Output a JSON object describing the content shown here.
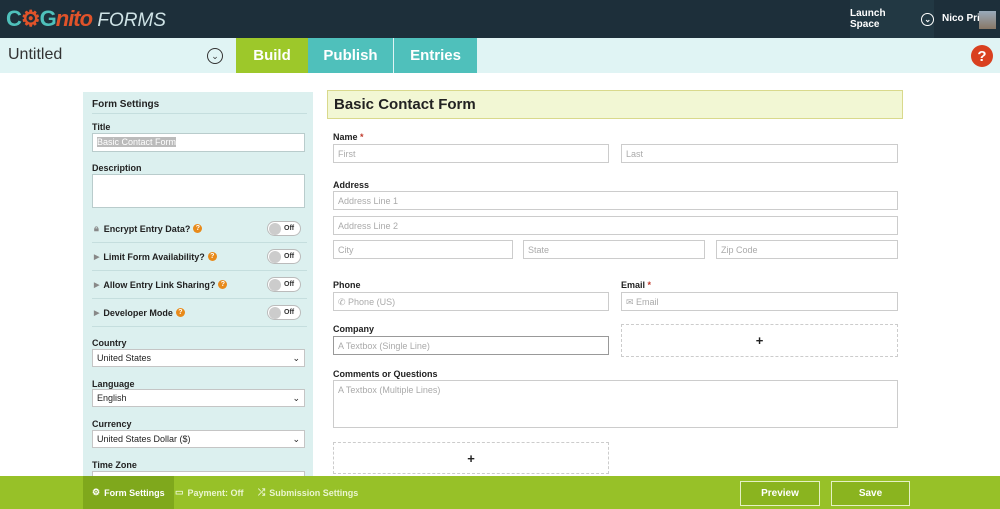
{
  "app": {
    "logo_text": "COGnito FORMS",
    "workspace": "Launch Space",
    "user": "Nico Pri"
  },
  "subbar": {
    "form_name": "Untitled",
    "tabs": [
      "Build",
      "Publish",
      "Entries"
    ],
    "help": "?"
  },
  "settings": {
    "heading": "Form Settings",
    "title_label": "Title",
    "title_value": "Basic Contact Form",
    "description_label": "Description",
    "toggles": [
      {
        "label": "Encrypt Entry Data?",
        "state": "Off"
      },
      {
        "label": "Limit Form Availability?",
        "state": "Off"
      },
      {
        "label": "Allow Entry Link Sharing?",
        "state": "Off"
      },
      {
        "label": "Developer Mode",
        "state": "Off"
      }
    ],
    "country_label": "Country",
    "country": "United States",
    "language_label": "Language",
    "language": "English",
    "currency_label": "Currency",
    "currency": "United States Dollar ($)",
    "timezone_label": "Time Zone"
  },
  "form": {
    "title": "Basic Contact Form",
    "name_label": "Name",
    "required": "*",
    "first": "First",
    "last": "Last",
    "address_label": "Address",
    "addr1": "Address Line 1",
    "addr2": "Address Line 2",
    "city": "City",
    "state": "State",
    "zip": "Zip Code",
    "phone_label": "Phone",
    "phone_ph": "Phone (US)",
    "email_label": "Email",
    "email_ph": "Email",
    "company_label": "Company",
    "company_ph": "Textbox (Single Line)",
    "comments_label": "Comments or Questions",
    "comments_ph": "Textbox (Multiple Lines)",
    "add": "+"
  },
  "bottom": {
    "form_settings": "Form Settings",
    "payment": "Payment: Off",
    "submission": "Submission Settings",
    "preview": "Preview",
    "save": "Save"
  },
  "colors": {
    "green": "#97c128",
    "teal": "#4fc0bb",
    "dark": "#1d2f3a"
  }
}
